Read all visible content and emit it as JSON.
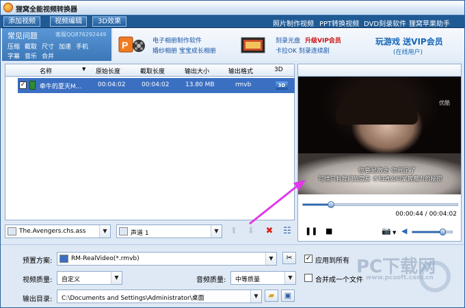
{
  "window": {
    "title": "狸窝全能视频转换器"
  },
  "toolbar": {
    "buttons": [
      "添加视频",
      "视频编辑",
      "3D效果"
    ],
    "links": [
      "照片制作视频",
      "PPT转换视频",
      "DVD刻录软件",
      "狸窝苹果助手"
    ]
  },
  "faq": {
    "title": "常见问题",
    "qq": "客服QQ876292449",
    "links_row1": [
      "压缩",
      "截取",
      "尺寸",
      "加速",
      "手机"
    ],
    "links_row2": [
      "字幕",
      "音乐",
      "合并"
    ]
  },
  "ads": {
    "ad1_line1": "电子相册制作软件",
    "ad1_line2": "婚纱相册  宝宝成长相册",
    "ad2_line1a": "刻录光盘",
    "ad2_line1b": "升级VIP会员",
    "ad2_line2": "卡拉OK  刻录连续剧",
    "promo_line1": "玩游戏  送VIP会员",
    "promo_line2": "(在线用户)",
    "colors": {
      "promo": "#1466b8",
      "vip": "#cc1010"
    }
  },
  "file_table": {
    "headers": [
      "名称",
      "原始长度",
      "截取长度",
      "输出大小",
      "输出格式",
      "3D"
    ],
    "rows": [
      {
        "checked": true,
        "name": "牵牛的夏天M...",
        "original_length": "00:04:02",
        "cut_length": "00:04:02",
        "output_size": "13.80 MB",
        "format": "rmvb",
        "icon_3d": "3D"
      }
    ]
  },
  "subtitle_select": {
    "value": "The.Avengers.chs.ass"
  },
  "audio_select": {
    "value": "声道 1"
  },
  "preview": {
    "watermark": "优酷",
    "subtitle_line1": "你要是敢走 你死定了",
    "subtitle_line2": "可惜只有我们的盟友 才知道如何掌握魔力的秘密",
    "time": "00:00:44 / 00:04:02",
    "progress": 0.18,
    "volume": 0.75
  },
  "settings": {
    "preset_label": "预置方案:",
    "preset_value": "RM-RealVideo(*.rmvb)",
    "apply_all_label": "应用到所有",
    "apply_all_checked": true,
    "video_quality_label": "视频质量:",
    "video_quality_value": "自定义",
    "audio_quality_label": "音频质量:",
    "audio_quality_value": "中等质量",
    "merge_label": "合并成一个文件",
    "merge_checked": false,
    "output_dir_label": "输出目录:",
    "output_dir_value": "C:\\Documents and Settings\\Administrator\\桌面"
  },
  "site_watermark": {
    "main": "PC下载网",
    "url": "www.pcsoft.com.cn"
  }
}
